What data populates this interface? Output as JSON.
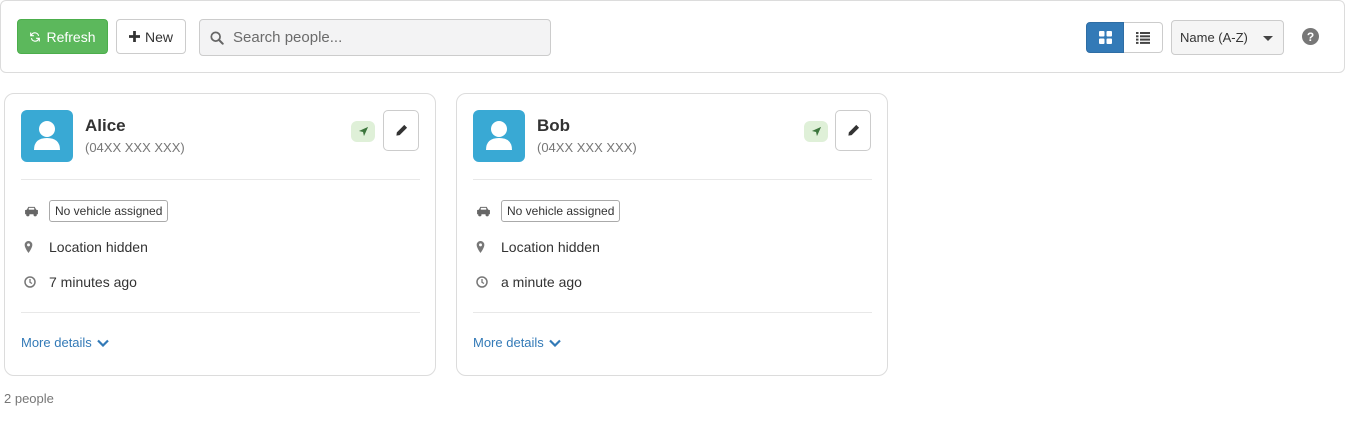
{
  "toolbar": {
    "refresh_label": "Refresh",
    "new_label": "New",
    "search_placeholder": "Search people...",
    "sort_selected": "Name (A-Z)",
    "help_glyph": "?"
  },
  "colors": {
    "refresh_green": "#5cb85c",
    "primary_blue": "#337ab7",
    "avatar_blue": "#39a9d4",
    "location_badge_bg": "#dff0d8"
  },
  "people": [
    {
      "name": "Alice",
      "phone": "(04XX XXX XXX)",
      "vehicle": "No vehicle assigned",
      "location": "Location hidden",
      "last_seen": "7 minutes ago",
      "more_label": "More details"
    },
    {
      "name": "Bob",
      "phone": "(04XX XXX XXX)",
      "vehicle": "No vehicle assigned",
      "location": "Location hidden",
      "last_seen": "a minute ago",
      "more_label": "More details"
    }
  ],
  "footer": {
    "count_text": "2 people"
  },
  "icons": [
    "refresh-icon",
    "plus-icon",
    "search-icon",
    "grid-view-icon",
    "list-view-icon",
    "help-icon",
    "user-avatar-icon",
    "location-arrow-icon",
    "pencil-icon",
    "car-icon",
    "map-marker-icon",
    "clock-icon",
    "chevron-down-icon"
  ]
}
